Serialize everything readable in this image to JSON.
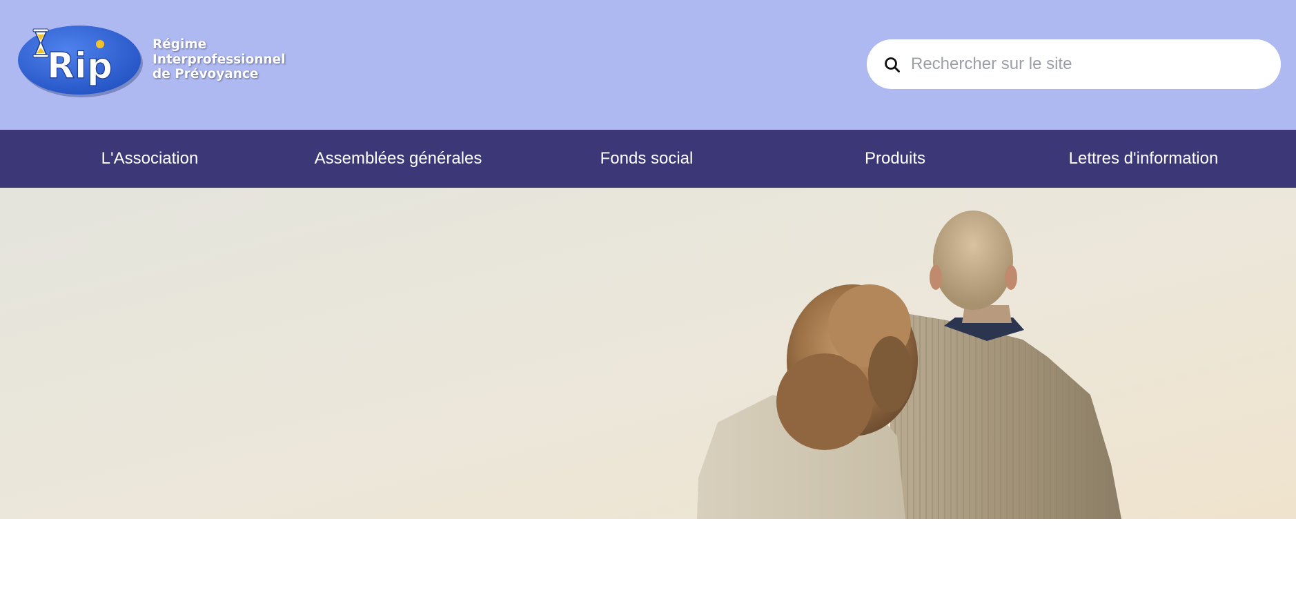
{
  "logo": {
    "wordmark": "Rip",
    "lines": [
      "Régime",
      "Interprofessionnel",
      "de Prévoyance"
    ],
    "colors": {
      "oval": "#3566d6",
      "sand": "#f2c12e"
    }
  },
  "search": {
    "placeholder": "Rechercher sur le site",
    "value": "",
    "icon": "search-icon"
  },
  "nav": {
    "items": [
      {
        "label": "L'Association"
      },
      {
        "label": "Assemblées générales"
      },
      {
        "label": "Fonds social"
      },
      {
        "label": "Produits"
      },
      {
        "label": "Lettres d'information"
      }
    ]
  },
  "hero": {
    "image": "elderly-couple-from-behind"
  },
  "colors": {
    "header_bg": "#aeb8f1",
    "nav_bg": "#3c3777",
    "nav_text": "#ffffff",
    "search_bg": "#ffffff"
  }
}
